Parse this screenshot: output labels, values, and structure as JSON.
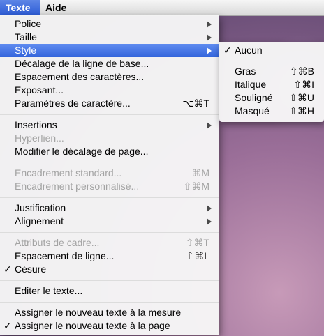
{
  "menubar": {
    "texte": "Texte",
    "aide": "Aide"
  },
  "menu": {
    "police": "Police",
    "taille": "Taille",
    "style": "Style",
    "decalage": "Décalage de la ligne de base...",
    "espacement_car": "Espacement des caractères...",
    "exposant": "Exposant...",
    "parametres": "Paramètres de caractère...",
    "parametres_sc": "⌥⌘T",
    "insertions": "Insertions",
    "hyperlien": "Hyperlien...",
    "modifier_decalage": "Modifier le décalage de page...",
    "encadrement_std": "Encadrement standard...",
    "encadrement_std_sc": "⌘M",
    "encadrement_perso": "Encadrement personnalisé...",
    "encadrement_perso_sc": "⇧⌘M",
    "justification": "Justification",
    "alignement": "Alignement",
    "attributs": "Attributs de cadre...",
    "attributs_sc": "⇧⌘T",
    "espacement_ligne": "Espacement de ligne...",
    "espacement_ligne_sc": "⇧⌘L",
    "cesure": "Césure",
    "editer": "Editer le texte...",
    "assigner_mesure": "Assigner le nouveau texte à la mesure",
    "assigner_page": "Assigner le nouveau texte à la page",
    "checkmark": "✓"
  },
  "submenu": {
    "aucun": "Aucun",
    "gras": "Gras",
    "gras_sc": "⇧⌘B",
    "italique": "Italique",
    "italique_sc": "⇧⌘I",
    "souligne": "Souligné",
    "souligne_sc": "⇧⌘U",
    "masque": "Masqué",
    "masque_sc": "⇧⌘H"
  }
}
